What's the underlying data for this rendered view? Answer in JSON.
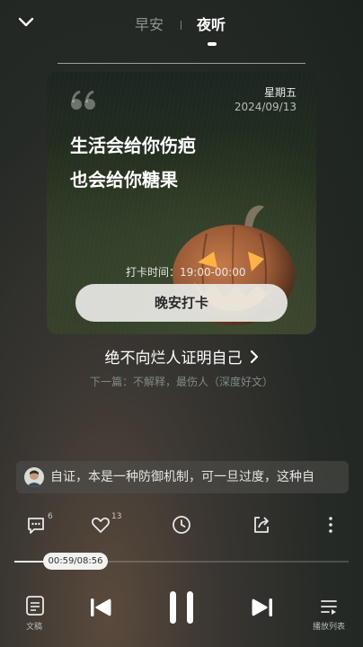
{
  "header": {
    "tabs": [
      {
        "label": "早安",
        "active": false
      },
      {
        "label": "夜听",
        "active": true
      }
    ]
  },
  "card": {
    "weekday": "星期五",
    "date": "2024/09/13",
    "quote_lines": [
      "生活会给你伤疤",
      "也会给你糖果"
    ],
    "checkin_time": "打卡时间：19:00-00:00",
    "checkin_button": "晚安打卡"
  },
  "track": {
    "title": "绝不向烂人证明自己",
    "next": "下一篇：不解释，最伤人（深度好文）"
  },
  "comment": {
    "text": "自证，本是一种防御机制，可一旦过度，这种自"
  },
  "actions": {
    "comment_count": "6",
    "like_count": "13"
  },
  "player": {
    "time": "00:59/08:56",
    "progress_fraction": 0.11
  },
  "bottom": {
    "doc_label": "文稿",
    "playlist_label": "播放列表"
  },
  "icons": [
    "chevron-down-icon",
    "quote-icon",
    "chevron-right-icon",
    "comment-icon",
    "heart-icon",
    "clock-icon",
    "share-icon",
    "more-icon",
    "document-icon",
    "previous-icon",
    "pause-icon",
    "next-icon",
    "playlist-icon"
  ]
}
